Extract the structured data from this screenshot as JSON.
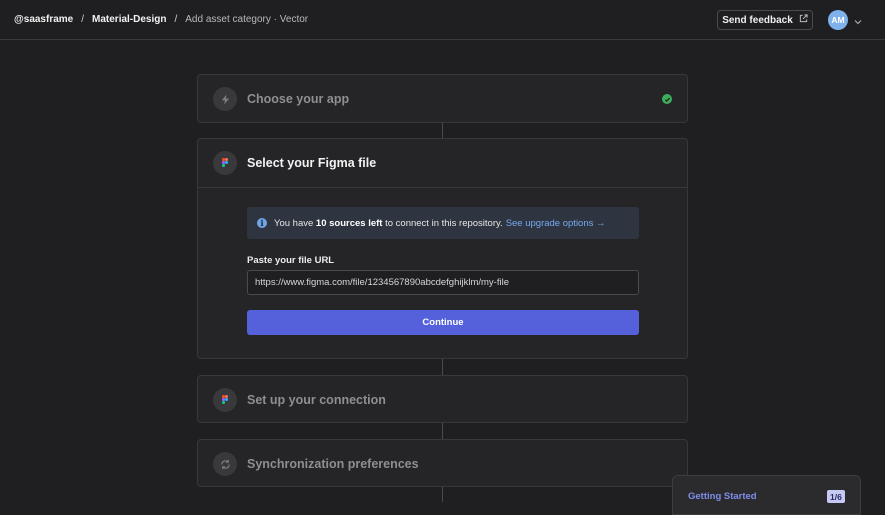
{
  "breadcrumb": {
    "org": "@saasframe",
    "project": "Material-Design",
    "page": "Add asset category · Vector",
    "separator": "/"
  },
  "header": {
    "feedback_label": "Send feedback",
    "avatar_initials": "AM"
  },
  "steps": [
    {
      "title": "Choose your app",
      "icon": "bolt-icon",
      "completed": true
    },
    {
      "title": "Select your Figma file",
      "icon": "figma-icon",
      "active": true
    },
    {
      "title": "Set up your connection",
      "icon": "figma-icon"
    },
    {
      "title": "Synchronization preferences",
      "icon": "sync-icon"
    }
  ],
  "notice": {
    "prefix": "You have ",
    "highlight": "10 sources left",
    "suffix": " to connect in this repository.",
    "link": "See upgrade options →"
  },
  "form": {
    "url_label": "Paste your file URL",
    "url_value": "https://www.figma.com/file/1234567890abcdefghijklm/my-file",
    "continue_label": "Continue"
  },
  "getting_started": {
    "title": "Getting Started",
    "progress": "1/6"
  },
  "colors": {
    "background": "#1f1f21",
    "card": "#252527",
    "accent": "#5561db",
    "success": "#3fae5a",
    "link": "#76a9f0",
    "avatar": "#7fb2ea"
  }
}
